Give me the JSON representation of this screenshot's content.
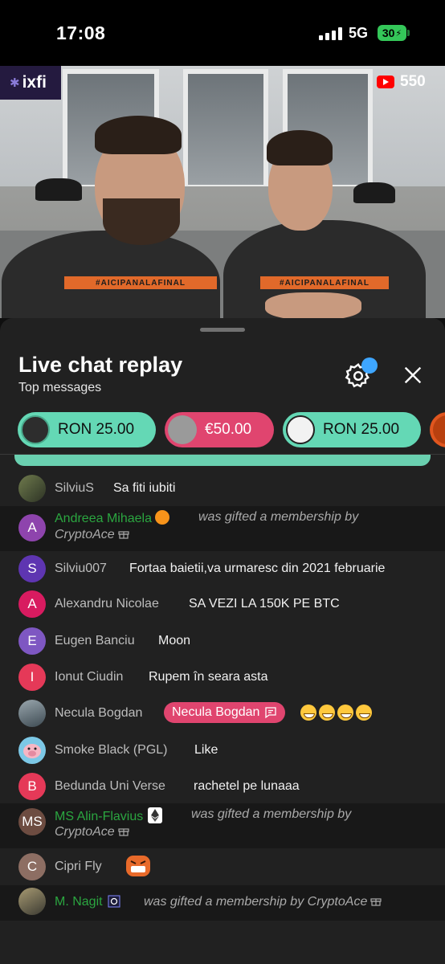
{
  "status_bar": {
    "time": "17:08",
    "network": "5G",
    "battery": "30"
  },
  "video": {
    "brand_logo_text": "ixfi",
    "youtube_count": "550",
    "shirt_text": "#AICIPANALAFINAL"
  },
  "panel": {
    "title": "Live chat replay",
    "subtitle": "Top messages"
  },
  "super_chats": [
    {
      "amount": "RON 25.00",
      "color": "#64d8b5"
    },
    {
      "amount": "€50.00",
      "color": "#e0456f"
    },
    {
      "amount": "RON 25.00",
      "color": "#64d8b5"
    }
  ],
  "messages": [
    {
      "type": "chat",
      "author": "SilviuS",
      "text": "Sa fiti iubiti"
    },
    {
      "type": "gift",
      "author": "Andreea Mihaela",
      "line1": "was gifted a membership by",
      "line2": "CryptoAce",
      "avatar_letter": "A",
      "avatar_color": "#8e44ad"
    },
    {
      "type": "chat",
      "author": "Silviu007",
      "text": "Fortaa baietii,va urmaresc din 2021 februarie",
      "avatar_letter": "S",
      "avatar_color": "#5e35b1"
    },
    {
      "type": "chat",
      "author": "Alexandru Nicolae",
      "text": "SA VEZI LA 150K PE BTC",
      "avatar_letter": "A",
      "avatar_color": "#d81b60"
    },
    {
      "type": "chat",
      "author": "Eugen Banciu",
      "text": "Moon",
      "avatar_letter": "E",
      "avatar_color": "#7e57c2"
    },
    {
      "type": "chat",
      "author": "Ionut Ciudin",
      "text": "Rupem în seara asta",
      "avatar_letter": "I",
      "avatar_color": "#e53958"
    },
    {
      "type": "chat",
      "author": "Necula Bogdan",
      "mention": "Necula Bogdan"
    },
    {
      "type": "chat",
      "author": "Smoke Black (PGL)",
      "text": "Like"
    },
    {
      "type": "chat",
      "author": "Bedunda Uni Verse",
      "text": "rachetel pe lunaaa",
      "avatar_letter": "B",
      "avatar_color": "#e53958"
    },
    {
      "type": "gift",
      "author": "MS Alin-Flavius",
      "line1": "was gifted a membership by",
      "line2": "CryptoAce",
      "avatar_letter": "MS",
      "avatar_color": "#6d4c41"
    },
    {
      "type": "chat",
      "author": "Cipri Fly",
      "avatar_letter": "C",
      "avatar_color": "#8d6e63"
    },
    {
      "type": "gift",
      "author": "M. Nagit",
      "line1": "was gifted a membership by CryptoAce"
    }
  ]
}
